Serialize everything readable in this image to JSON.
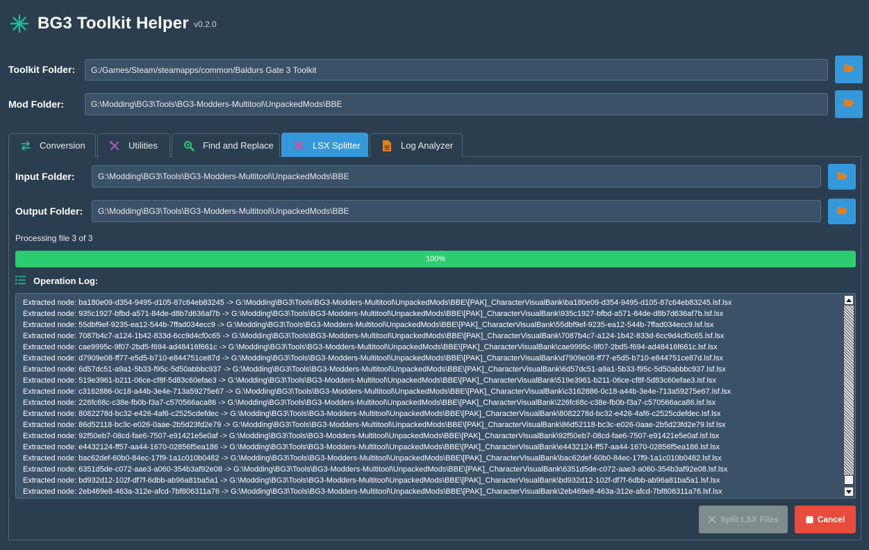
{
  "app": {
    "title": "BG3 Toolkit Helper",
    "version": "v0.2.0"
  },
  "toolkit_folder": {
    "label": "Toolkit Folder:",
    "value": "G:/Games/Steam/steamapps/common/Baldurs Gate 3 Toolkit"
  },
  "mod_folder": {
    "label": "Mod Folder:",
    "value": "G:\\Modding\\BG3\\Tools\\BG3-Modders-Multitool\\UnpackedMods\\BBE"
  },
  "tabs": [
    {
      "label": "Conversion",
      "icon": "arrows-exchange-icon",
      "active": false
    },
    {
      "label": "Utilities",
      "icon": "tools-icon",
      "active": false
    },
    {
      "label": "Find and Replace",
      "icon": "search-icon",
      "active": false
    },
    {
      "label": "LSX Splitter",
      "icon": "scissors-icon",
      "active": true
    },
    {
      "label": "Log Analyzer",
      "icon": "document-icon",
      "active": false
    }
  ],
  "splitter": {
    "input_label": "Input Folder:",
    "input_value": "G:\\Modding\\BG3\\Tools\\BG3-Modders-Multitool\\UnpackedMods\\BBE",
    "output_label": "Output Folder:",
    "output_value": "G:\\Modding\\BG3\\Tools\\BG3-Modders-Multitool\\UnpackedMods\\BBE",
    "status_text": "Processing file 3 of 3",
    "progress": 1.0,
    "progress_label": "100%",
    "log_title": "Operation Log:",
    "log_lines": [
      "Extracted node: ba180e09-d354-9495-d105-87c64eb83245 -> G:\\Modding\\BG3\\Tools\\BG3-Modders-Multitool\\UnpackedMods\\BBE\\[PAK]_CharacterVisualBank\\ba180e09-d354-9495-d105-87c64eb83245.lsf.lsx",
      "Extracted node: 935c1927-bfbd-a571-84de-d8b7d636af7b -> G:\\Modding\\BG3\\Tools\\BG3-Modders-Multitool\\UnpackedMods\\BBE\\[PAK]_CharacterVisualBank\\935c1927-bfbd-a571-84de-d8b7d636af7b.lsf.lsx",
      "Extracted node: 55dbf9ef-9235-ea12-544b-7ffad034ecc9 -> G:\\Modding\\BG3\\Tools\\BG3-Modders-Multitool\\UnpackedMods\\BBE\\[PAK]_CharacterVisualBank\\55dbf9ef-9235-ea12-544b-7ffad034ecc9.lsf.lsx",
      "Extracted node: 7087b4c7-a124-1b42-833d-6cc9d4cf0c65 -> G:\\Modding\\BG3\\Tools\\BG3-Modders-Multitool\\UnpackedMods\\BBE\\[PAK]_CharacterVisualBank\\7087b4c7-a124-1b42-833d-6cc9d4cf0c65.lsf.lsx",
      "Extracted node: cae9995c-9f07-2bd5-f694-ad48416f661c -> G:\\Modding\\BG3\\Tools\\BG3-Modders-Multitool\\UnpackedMods\\BBE\\[PAK]_CharacterVisualBank\\cae9995c-9f07-2bd5-f694-ad48416f661c.lsf.lsx",
      "Extracted node: d7909e08-ff77-e5d5-b710-e844751ce87d -> G:\\Modding\\BG3\\Tools\\BG3-Modders-Multitool\\UnpackedMods\\BBE\\[PAK]_CharacterVisualBank\\d7909e08-ff77-e5d5-b710-e844751ce87d.lsf.lsx",
      "Extracted node: 6d57dc51-a9a1-5b33-f95c-5d50abbbc937 -> G:\\Modding\\BG3\\Tools\\BG3-Modders-Multitool\\UnpackedMods\\BBE\\[PAK]_CharacterVisualBank\\6d57dc51-a9a1-5b33-f95c-5d50abbbc937.lsf.lsx",
      "Extracted node: 519e3961-b211-06ce-cf8f-5d83c60efae3 -> G:\\Modding\\BG3\\Tools\\BG3-Modders-Multitool\\UnpackedMods\\BBE\\[PAK]_CharacterVisualBank\\519e3961-b211-06ce-cf8f-5d83c60efae3.lsf.lsx",
      "Extracted node: c3162886-0c18-a44b-3e4e-713a59275e67 -> G:\\Modding\\BG3\\Tools\\BG3-Modders-Multitool\\UnpackedMods\\BBE\\[PAK]_CharacterVisualBank\\c3162886-0c18-a44b-3e4e-713a59275e67.lsf.lsx",
      "Extracted node: 226fc68c-c38e-fb0b-f3a7-c570566aca86 -> G:\\Modding\\BG3\\Tools\\BG3-Modders-Multitool\\UnpackedMods\\BBE\\[PAK]_CharacterVisualBank\\226fc68c-c38e-fb0b-f3a7-c570566aca86.lsf.lsx",
      "Extracted node: 8082278d-bc32-e426-4af6-c2525cdefdec -> G:\\Modding\\BG3\\Tools\\BG3-Modders-Multitool\\UnpackedMods\\BBE\\[PAK]_CharacterVisualBank\\8082278d-bc32-e426-4af6-c2525cdefdec.lsf.lsx",
      "Extracted node: 86d52118-bc3c-e026-0aae-2b5d23fd2e79 -> G:\\Modding\\BG3\\Tools\\BG3-Modders-Multitool\\UnpackedMods\\BBE\\[PAK]_CharacterVisualBank\\86d52118-bc3c-e026-0aae-2b5d23fd2e79.lsf.lsx",
      "Extracted node: 92f50eb7-08cd-fae6-7507-e91421e5e0af -> G:\\Modding\\BG3\\Tools\\BG3-Modders-Multitool\\UnpackedMods\\BBE\\[PAK]_CharacterVisualBank\\92f50eb7-08cd-fae6-7507-e91421e5e0af.lsf.lsx",
      "Extracted node: e4432124-ff57-aa44-1670-02856f5ea186 -> G:\\Modding\\BG3\\Tools\\BG3-Modders-Multitool\\UnpackedMods\\BBE\\[PAK]_CharacterVisualBank\\e4432124-ff57-aa44-1670-02856f5ea186.lsf.lsx",
      "Extracted node: bac62def-60b0-84ec-17f9-1a1c010b0482 -> G:\\Modding\\BG3\\Tools\\BG3-Modders-Multitool\\UnpackedMods\\BBE\\[PAK]_CharacterVisualBank\\bac62def-60b0-84ec-17f9-1a1c010b0482.lsf.lsx",
      "Extracted node: 6351d5de-c072-aae3-a060-354b3af92e08 -> G:\\Modding\\BG3\\Tools\\BG3-Modders-Multitool\\UnpackedMods\\BBE\\[PAK]_CharacterVisualBank\\6351d5de-c072-aae3-a060-354b3af92e08.lsf.lsx",
      "Extracted node: bd932d12-102f-df7f-6dbb-ab96a81ba5a1 -> G:\\Modding\\BG3\\Tools\\BG3-Modders-Multitool\\UnpackedMods\\BBE\\[PAK]_CharacterVisualBank\\bd932d12-102f-df7f-6dbb-ab96a81ba5a1.lsf.lsx",
      "Extracted node: 2eb469e8-463a-312e-afcd-7bf806311a76 -> G:\\Modding\\BG3\\Tools\\BG3-Modders-Multitool\\UnpackedMods\\BBE\\[PAK]_CharacterVisualBank\\2eb469e8-463a-312e-afcd-7bf806311a76.lsf.lsx"
    ],
    "split_button": "Split LSX Files",
    "cancel_button": "Cancel"
  },
  "colors": {
    "background": "#2b3e50",
    "accent": "#3498db",
    "progress": "#2ecc71",
    "danger": "#e74c3c",
    "input_bg": "#3b5168"
  }
}
